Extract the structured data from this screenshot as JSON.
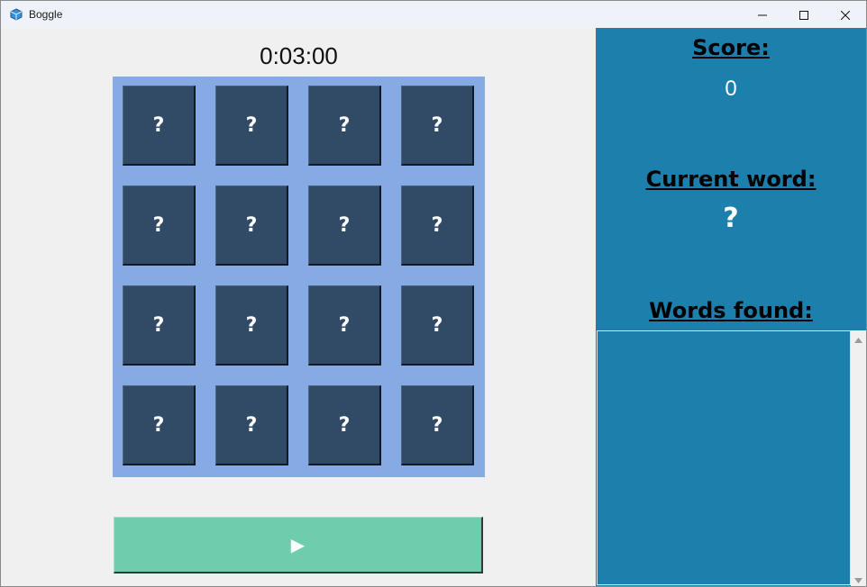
{
  "window": {
    "title": "Boggle",
    "icon": "boggle-cube-icon",
    "controls": [
      "minimize-icon",
      "maximize-icon",
      "close-icon"
    ]
  },
  "game": {
    "timer": "0:03:00",
    "board": [
      [
        "?",
        "?",
        "?",
        "?"
      ],
      [
        "?",
        "?",
        "?",
        "?"
      ],
      [
        "?",
        "?",
        "?",
        "?"
      ],
      [
        "?",
        "?",
        "?",
        "?"
      ]
    ],
    "play_label": "▶"
  },
  "sidebar": {
    "score_heading": "Score:",
    "score_value": "0",
    "current_word_heading": "Current word:",
    "current_word_value": "?",
    "words_found_heading": "Words found:",
    "words_found": []
  },
  "colors": {
    "board_bg": "#86aae3",
    "cell_bg": "#314a66",
    "play_button": "#6fcdae",
    "sidebar_bg": "#1c7fac"
  }
}
